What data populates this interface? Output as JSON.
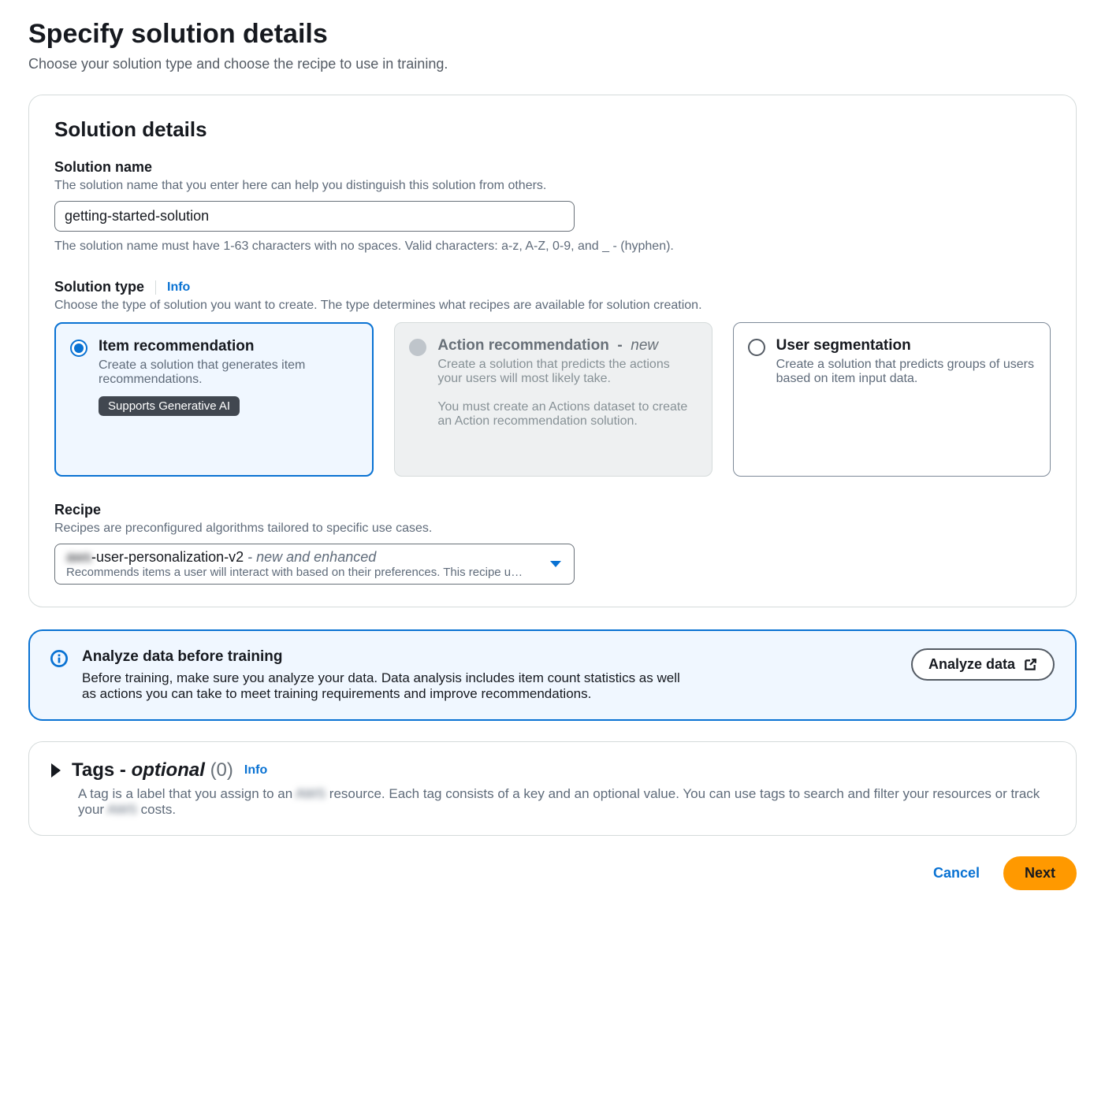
{
  "page": {
    "title": "Specify solution details",
    "subtitle": "Choose your solution type and choose the recipe to use in training."
  },
  "panel": {
    "title": "Solution details",
    "solutionName": {
      "label": "Solution name",
      "hint": "The solution name that you enter here can help you distinguish this solution from others.",
      "value": "getting-started-solution",
      "constraint": "The solution name must have 1-63 characters with no spaces. Valid characters: a-z, A-Z, 0-9, and _ - (hyphen)."
    },
    "solutionType": {
      "label": "Solution type",
      "infoLabel": "Info",
      "hint": "Choose the type of solution you want to create. The type determines what recipes are available for solution creation.",
      "options": [
        {
          "title": "Item recommendation",
          "desc": "Create a solution that generates item recommendations.",
          "pill": "Supports Generative AI",
          "selected": true,
          "disabled": false
        },
        {
          "title": "Action recommendation",
          "newLabel": "new",
          "desc": "Create a solution that predicts the actions your users will most likely take.",
          "warn": "You must create an Actions dataset to create an Action recommendation solution.",
          "selected": false,
          "disabled": true
        },
        {
          "title": "User segmentation",
          "desc": "Create a solution that predicts groups of users based on item input data.",
          "selected": false,
          "disabled": false
        }
      ]
    },
    "recipe": {
      "label": "Recipe",
      "hint": "Recipes are preconfigured algorithms tailored to specific use cases.",
      "selectedPrefix": "aws",
      "selectedName": "-user-personalization-v2",
      "selectedSuffix": " - new and enhanced",
      "selectedDesc": "Recommends items a user will interact with based on their preferences. This recipe u…"
    }
  },
  "alert": {
    "title": "Analyze data before training",
    "text": "Before training, make sure you analyze your data. Data analysis includes item count statistics as well as actions you can take to meet training requirements and improve recommendations.",
    "button": "Analyze data"
  },
  "tags": {
    "titlePrefix": "Tags - ",
    "optional": "optional",
    "count": "(0)",
    "infoLabel": "Info",
    "descPrefix": "A tag is a label that you assign to an ",
    "descBlur1": "AWS",
    "descMid": " resource. Each tag consists of a key and an optional value. You can use tags to search and filter your resources or track your ",
    "descBlur2": "AWS",
    "descSuffix": " costs."
  },
  "footer": {
    "cancel": "Cancel",
    "next": "Next"
  }
}
